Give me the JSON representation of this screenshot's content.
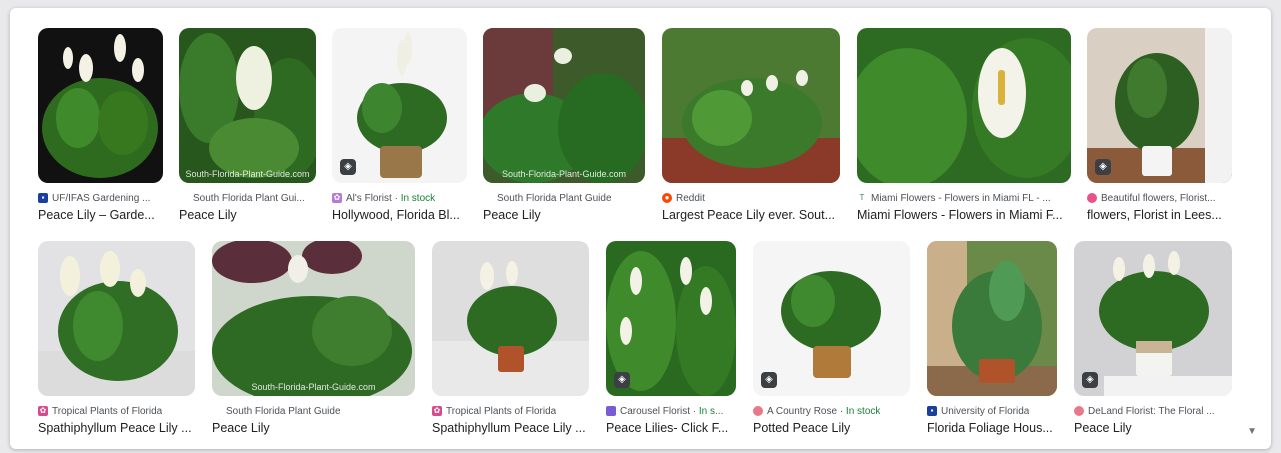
{
  "results": {
    "row1": [
      {
        "source": "UF/IFAS Gardening ...",
        "title": "Peace Lily – Garde...",
        "stock": "",
        "watermark": "",
        "tag": false
      },
      {
        "source": "South Florida Plant Gui...",
        "title": "Peace Lily",
        "stock": "",
        "watermark": "South-Florida-Plant-Guide.com",
        "tag": false
      },
      {
        "source": "Al's Florist · ",
        "title": "Hollywood, Florida Bl...",
        "stock": "In stock",
        "watermark": "",
        "tag": true
      },
      {
        "source": "South Florida Plant Guide",
        "title": "Peace Lily",
        "stock": "",
        "watermark": "South-Florida-Plant-Guide.com",
        "tag": false
      },
      {
        "source": "Reddit",
        "title": "Largest Peace Lily ever. Sout...",
        "stock": "",
        "watermark": "",
        "tag": false
      },
      {
        "source": "Miami Flowers - Flowers in Miami FL - ...",
        "title": "Miami Flowers - Flowers in Miami F...",
        "stock": "",
        "watermark": "",
        "tag": false
      },
      {
        "source": "Beautiful flowers, Florist...",
        "title": "flowers, Florist in Lees...",
        "stock": "",
        "watermark": "",
        "tag": true
      }
    ],
    "row2": [
      {
        "source": "Tropical Plants of Florida",
        "title": "Spathiphyllum Peace Lily ...",
        "stock": "",
        "watermark": "",
        "tag": false
      },
      {
        "source": "South Florida Plant Guide",
        "title": "Peace Lily",
        "stock": "",
        "watermark": "South-Florida-Plant-Guide.com",
        "tag": false
      },
      {
        "source": "Tropical Plants of Florida",
        "title": "Spathiphyllum Peace Lily ...",
        "stock": "",
        "watermark": "",
        "tag": false
      },
      {
        "source": "Carousel Florist · ",
        "title": "Peace Lilies- Click F...",
        "stock": "In s...",
        "watermark": "",
        "tag": true
      },
      {
        "source": "A Country Rose · ",
        "title": "Potted Peace Lily",
        "stock": "In stock",
        "watermark": "",
        "tag": true
      },
      {
        "source": "University of Florida",
        "title": "Florida Foliage Hous...",
        "stock": "",
        "watermark": "",
        "tag": false
      },
      {
        "source": "DeLand Florist: The Floral ...",
        "title": "Peace Lily",
        "stock": "",
        "watermark": "",
        "tag": true
      }
    ]
  },
  "icons": {
    "favicons": [
      "uf-favicon",
      "sfpg-favicon",
      "flower-favicon",
      "sfpg-favicon",
      "reddit-favicon",
      "t-favicon",
      "pink-dot-favicon",
      "tropical-favicon",
      "sfpg-favicon",
      "tropical-favicon",
      "carousel-favicon",
      "rose-favicon",
      "uf-favicon",
      "rose-favicon"
    ],
    "tag_icon": "tag-icon",
    "scroll": "chevron-down-icon"
  },
  "scroll_glyph": "▼",
  "tag_glyph": "◈"
}
